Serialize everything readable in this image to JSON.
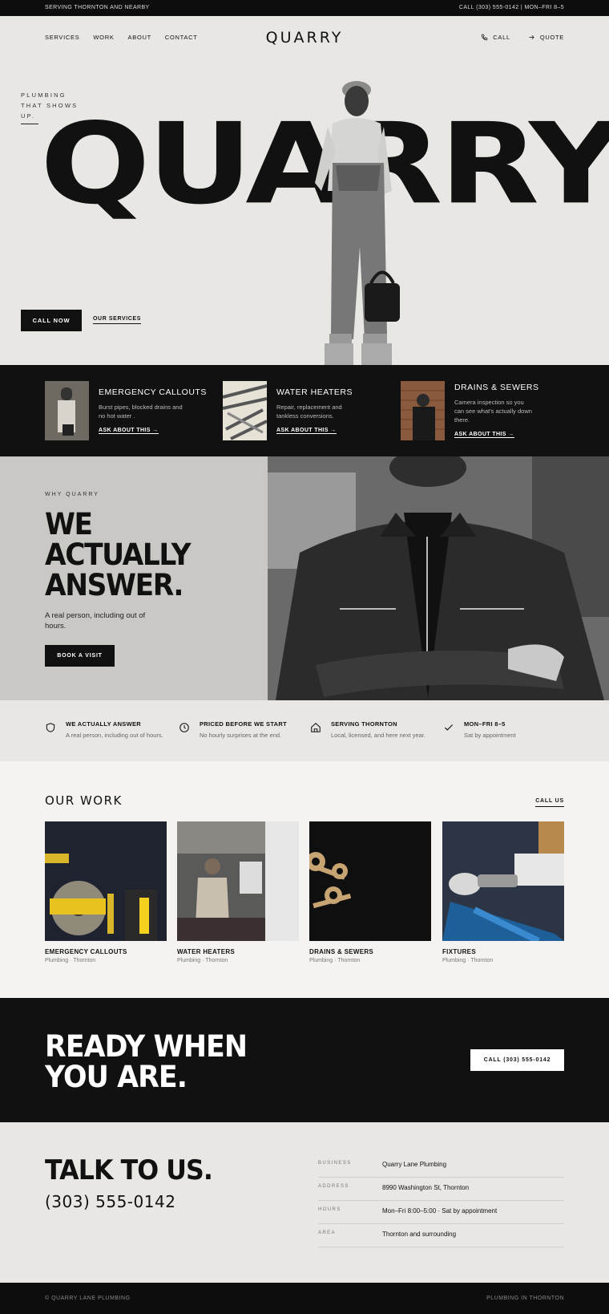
{
  "topbar": {
    "left": "SERVING THORNTON AND NEARBY",
    "right": "CALL (303) 555-0142  |  MON–FRI 8–5"
  },
  "nav": {
    "links": [
      "SERVICES",
      "WORK",
      "ABOUT",
      "CONTACT"
    ],
    "logo": "QUARRY",
    "call": "CALL",
    "quote": "QUOTE"
  },
  "hero": {
    "tagline_1": "PLUMBING",
    "tagline_2": "THAT SHOWS",
    "tagline_3": "UP.",
    "big_word": "QUARRY",
    "cta_call": "CALL NOW",
    "cta_services": "OUR SERVICES"
  },
  "services": [
    {
      "title": "EMERGENCY CALLOUTS",
      "desc": "Burst pipes, blocked drains and no hot water .",
      "link": "ASK ABOUT THIS →"
    },
    {
      "title": "WATER HEATERS",
      "desc": "Repair, replacement and tankless conversions.",
      "link": "ASK ABOUT THIS →"
    },
    {
      "title": "DRAINS & SEWERS",
      "desc": "Camera inspection so you can see what's actually down there.",
      "link": "ASK ABOUT THIS →"
    }
  ],
  "why": {
    "label": "WHY QUARRY",
    "title_1": "WE",
    "title_2": "ACTUALLY",
    "title_3": "ANSWER.",
    "text": "A real person, including out of hours.",
    "button": "BOOK A VISIT"
  },
  "features": [
    {
      "icon": "shield-icon",
      "title": "WE ACTUALLY ANSWER",
      "desc": "A real person, including out of hours."
    },
    {
      "icon": "clock-icon",
      "title": "PRICED BEFORE WE START",
      "desc": "No hourly surprises at the end."
    },
    {
      "icon": "home-icon",
      "title": "SERVING THORNTON",
      "desc": "Local, licensed, and here next year."
    },
    {
      "icon": "check-icon",
      "title": "MON–FRI 8–5",
      "desc": "Sat by appointment"
    }
  ],
  "work": {
    "title": "OUR WORK",
    "call_us": "CALL US",
    "cards": [
      {
        "title": "EMERGENCY CALLOUTS",
        "sub": "Plumbing · Thornton"
      },
      {
        "title": "WATER HEATERS",
        "sub": "Plumbing · Thornton"
      },
      {
        "title": "DRAINS & SEWERS",
        "sub": "Plumbing · Thornton"
      },
      {
        "title": "FIXTURES",
        "sub": "Plumbing · Thornton"
      }
    ]
  },
  "ready": {
    "title_1": "READY WHEN",
    "title_2": "YOU ARE.",
    "button": "CALL (303) 555-0142"
  },
  "talk": {
    "title": "TALK TO US.",
    "phone": "(303) 555-0142",
    "info": [
      {
        "key": "BUSINESS",
        "value": "Quarry Lane Plumbing"
      },
      {
        "key": "ADDRESS",
        "value": "8990 Washington St, Thornton"
      },
      {
        "key": "HOURS",
        "value": "Mon–Fri 8:00–5:00 · Sat by appointment"
      },
      {
        "key": "AREA",
        "value": "Thornton and surrounding"
      }
    ]
  },
  "footer": {
    "left": "© QUARRY LANE PLUMBING",
    "right": "PLUMBING IN THORNTON"
  }
}
